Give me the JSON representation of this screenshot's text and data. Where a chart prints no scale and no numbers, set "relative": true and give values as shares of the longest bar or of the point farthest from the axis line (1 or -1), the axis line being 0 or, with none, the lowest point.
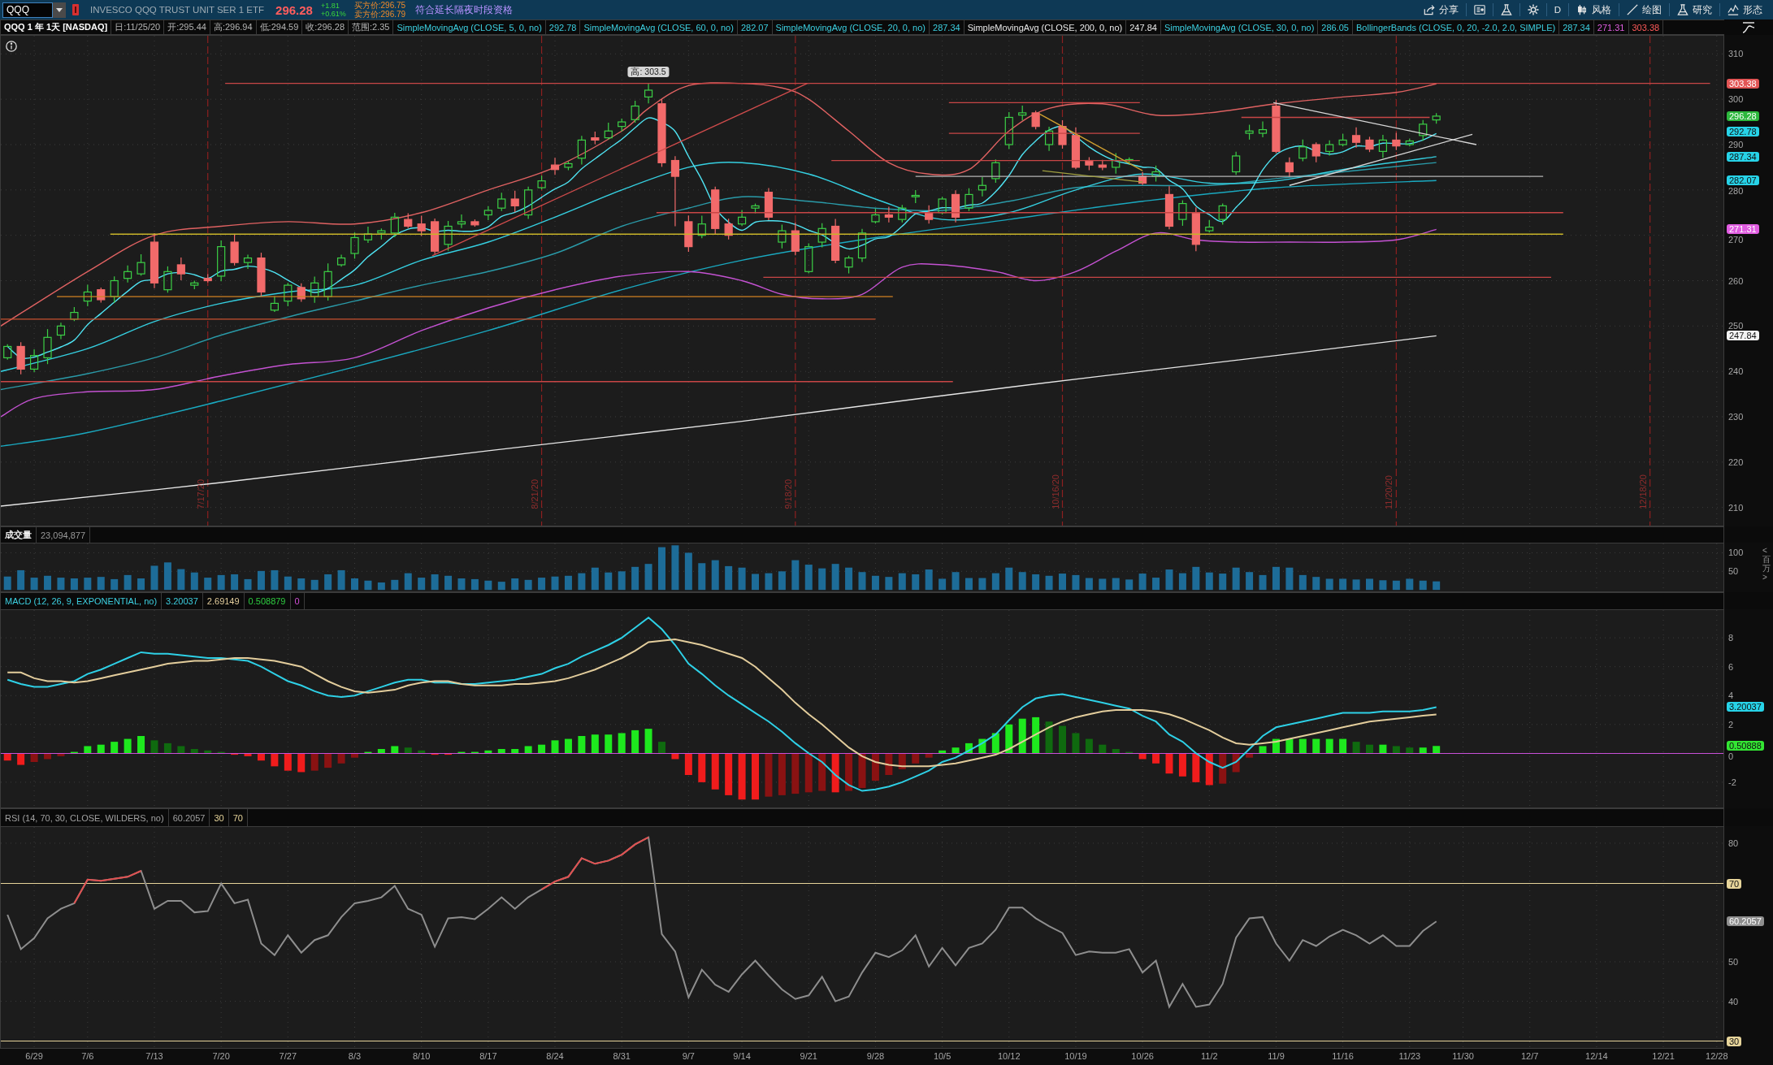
{
  "toolbar": {
    "symbol": "QQQ",
    "description": "INVESCO QQQ TRUST UNIT SER 1 ETF",
    "last_price": "296.28",
    "change": "+1.81",
    "change_percent": "+0.61%",
    "bid": "买方价:296.75",
    "ask": "卖方价:296.79",
    "session_badge": "符合延长隔夜时段资格",
    "buttons": [
      {
        "kind": "share",
        "label": "分享"
      },
      {
        "kind": "news"
      },
      {
        "kind": "flask"
      },
      {
        "kind": "gear"
      },
      {
        "kind": "text",
        "label": "D"
      },
      {
        "kind": "style",
        "label": "风格"
      },
      {
        "kind": "draw",
        "label": "绘图"
      },
      {
        "kind": "flask",
        "label": "研究"
      },
      {
        "kind": "pattern",
        "label": "形态"
      }
    ]
  },
  "study_bar": {
    "title": "QQQ 1 年 1天 [NASDAQ]",
    "quote": [
      "日:11/25/20",
      "开:295.44",
      "高:296.94",
      "低:294.59",
      "收:296.28",
      "范围:2.35"
    ],
    "studies": [
      {
        "label": "SimpleMovingAvg (CLOSE, 5, 0, no)",
        "values": [
          "292.78"
        ]
      },
      {
        "label": "SimpleMovingAvg (CLOSE, 60, 0, no)",
        "values": [
          "282.07"
        ]
      },
      {
        "label": "SimpleMovingAvg (CLOSE, 20, 0, no)",
        "values": [
          "287.34"
        ]
      },
      {
        "label": "SimpleMovingAvg (CLOSE, 200, 0, no)",
        "values": [
          "247.84"
        ]
      },
      {
        "label": "SimpleMovingAvg (CLOSE, 30, 0, no)",
        "values": [
          "286.05"
        ]
      },
      {
        "label": "BollingerBands (CLOSE, 0, 20, -2.0, 2.0, SIMPLE)",
        "values": [
          "287.34",
          "271.31",
          "303.38"
        ]
      }
    ]
  },
  "price_chart": {
    "y_axis_labels": [
      "310",
      "300",
      "290",
      "280",
      "270",
      "260",
      "250",
      "240",
      "230",
      "220",
      "210"
    ],
    "value_tags": [
      {
        "text": "303.38",
        "color": "#e25555"
      },
      {
        "text": "296.28",
        "color": "#2db83d"
      },
      {
        "text": "292.78",
        "color": "#27d3e8"
      },
      {
        "text": "287.34",
        "color": "#27d3e8"
      },
      {
        "text": "282.07",
        "color": "#27d3e8"
      },
      {
        "text": "271.31",
        "color": "#e05ce0"
      },
      {
        "text": "247.84",
        "color": "#f2f2f2"
      }
    ],
    "high_callout": "高: 303.5",
    "expiration_labels": [
      "7/17/20",
      "8/21/20",
      "9/18/20",
      "10/16/20",
      "11/20/20",
      "12/18/20"
    ]
  },
  "volume_panel": {
    "header": [
      "成交量",
      "23,094,877"
    ],
    "chart_data": {
      "type": "bar",
      "grid": true,
      "categories": [
        null,
        null,
        null,
        null,
        null,
        null,
        null,
        null,
        null,
        null,
        null,
        null,
        null,
        null,
        null,
        null,
        null,
        null,
        null,
        null,
        null,
        null,
        null,
        null,
        null,
        null,
        null,
        null,
        null,
        null,
        null,
        null,
        null,
        null,
        null,
        null,
        null,
        null,
        null,
        null,
        null,
        null,
        null,
        null,
        null,
        null,
        null,
        null,
        null,
        null,
        null,
        null,
        null,
        null,
        null,
        null,
        null,
        null,
        null,
        null,
        null,
        null,
        null,
        null,
        null,
        null,
        null,
        null,
        null,
        null,
        null,
        null,
        null,
        null,
        null,
        null,
        null,
        null,
        null,
        null,
        null,
        null,
        null,
        null,
        null,
        null,
        null,
        null,
        null,
        null,
        null,
        null,
        null,
        null,
        null,
        null,
        null,
        null,
        null,
        null,
        null,
        null,
        null,
        null,
        null,
        null,
        null,
        null,
        null,
        null,
        null,
        null,
        null,
        null,
        null,
        null,
        null,
        null,
        null,
        null,
        null,
        null,
        null,
        null,
        null,
        null,
        null,
        null,
        null
      ],
      "ylabel": "<百万>",
      "ylim": [
        -4,
        125
      ],
      "yticks": [
        50,
        100
      ],
      "values": [
        36,
        53,
        33,
        38,
        33,
        31,
        33,
        35,
        29,
        40,
        31,
        65,
        74,
        56,
        47,
        33,
        40,
        42,
        29,
        51,
        53,
        36,
        31,
        27,
        42,
        53,
        31,
        25,
        20,
        27,
        45,
        33,
        42,
        38,
        31,
        29,
        25,
        22,
        31,
        27,
        33,
        36,
        38,
        45,
        60,
        47,
        50,
        62,
        70,
        115,
        120,
        100,
        72,
        80,
        64,
        60,
        43,
        45,
        50,
        80,
        68,
        58,
        70,
        60,
        48,
        38,
        35,
        45,
        42,
        55,
        30,
        48,
        32,
        32,
        45,
        60,
        48,
        42,
        38,
        44,
        40,
        32,
        30,
        32,
        28,
        44,
        33,
        55,
        45,
        62,
        47,
        44,
        60,
        48,
        40,
        62,
        60,
        40,
        35,
        30,
        30,
        28,
        30,
        26,
        25,
        30,
        25,
        23,
        null,
        null,
        null,
        null,
        null,
        null,
        null,
        null,
        null,
        null,
        null,
        null,
        null,
        null,
        null,
        null,
        null,
        null,
        null,
        null,
        null
      ]
    }
  },
  "macd_panel": {
    "header": [
      "MACD (12, 26, 9, EXPONENTIAL, no)",
      "3.20037",
      "2.69149",
      "0.508879",
      "0"
    ],
    "lines": {
      "chart_data": {
        "type": "line",
        "grid": true,
        "categories": [
          null,
          null,
          null,
          null,
          null,
          null,
          null,
          null,
          null,
          null,
          null,
          null,
          null,
          null,
          null,
          null,
          null,
          null,
          null,
          null,
          null,
          null,
          null,
          null,
          null,
          null,
          null,
          null,
          null,
          null,
          null,
          null,
          null,
          null,
          null,
          null,
          null,
          null,
          null,
          null,
          null,
          null,
          null,
          null,
          null,
          null,
          null,
          null,
          null,
          null,
          null,
          null,
          null,
          null,
          null,
          null,
          null,
          null,
          null,
          null,
          null,
          null,
          null,
          null,
          null,
          null,
          null,
          null,
          null,
          null,
          null,
          null,
          null,
          null,
          null,
          null,
          null,
          null,
          null,
          null,
          null,
          null,
          null,
          null,
          null,
          null,
          null,
          null,
          null,
          null,
          null,
          null,
          null,
          null,
          null,
          null,
          null,
          null,
          null,
          null,
          null,
          null,
          null,
          null,
          null,
          null,
          null,
          null,
          null,
          null,
          null,
          null,
          null,
          null,
          null,
          null,
          null,
          null,
          null,
          null,
          null,
          null,
          null,
          null,
          null,
          null,
          null,
          null,
          null
        ],
        "ylim": [
          -3.75,
          9.92
        ],
        "yticks": [
          -2,
          0,
          2,
          4,
          6,
          8
        ],
        "ref_lines": [
          {
            "axis": "y",
            "value": 0,
            "color": "#c84fd8"
          }
        ],
        "series": [
          {
            "color": "#2ed0e6",
            "values": [
              5.1,
              4.8,
              4.6,
              4.6,
              4.8,
              5.0,
              5.5,
              5.8,
              6.2,
              6.6,
              7.0,
              6.9,
              6.9,
              6.8,
              6.7,
              6.6,
              6.6,
              6.5,
              6.4,
              6.0,
              5.5,
              5.0,
              4.7,
              4.3,
              4.0,
              3.9,
              4.0,
              4.3,
              4.6,
              4.9,
              5.1,
              5.1,
              4.9,
              4.9,
              4.8,
              4.8,
              4.9,
              5.0,
              5.1,
              5.3,
              5.5,
              5.9,
              6.2,
              6.7,
              7.1,
              7.5,
              8.0,
              8.7,
              9.4,
              8.6,
              7.5,
              6.2,
              5.5,
              4.7,
              4.0,
              3.4,
              2.8,
              2.2,
              1.5,
              0.7,
              0.0,
              -0.6,
              -1.5,
              -2.2,
              -2.6,
              -2.5,
              -2.3,
              -2.0,
              -1.6,
              -1.2,
              -0.6,
              -0.3,
              0.2,
              0.7,
              1.3,
              2.3,
              3.2,
              3.8,
              4.0,
              4.1,
              3.9,
              3.7,
              3.5,
              3.3,
              3.1,
              2.6,
              2.2,
              1.3,
              0.8,
              0.0,
              -0.6,
              -1.0,
              -0.6,
              0.3,
              1.2,
              1.8,
              2.0,
              2.2,
              2.4,
              2.6,
              2.8,
              2.8,
              2.8,
              2.9,
              2.9,
              2.9,
              3.0,
              3.2,
              null,
              null,
              null,
              null,
              null,
              null,
              null,
              null,
              null,
              null,
              null,
              null,
              null,
              null,
              null,
              null,
              null,
              null,
              null,
              null,
              null
            ]
          },
          {
            "color": "#e3cd9c",
            "values": [
              5.6,
              5.6,
              5.2,
              5.0,
              5.0,
              4.9,
              5.0,
              5.2,
              5.4,
              5.6,
              5.8,
              6.0,
              6.2,
              6.3,
              6.4,
              6.4,
              6.5,
              6.6,
              6.6,
              6.5,
              6.4,
              6.2,
              6.0,
              5.5,
              5.0,
              4.6,
              4.3,
              4.2,
              4.3,
              4.4,
              4.7,
              4.9,
              5.0,
              5.0,
              4.8,
              4.7,
              4.7,
              4.7,
              4.8,
              4.8,
              4.9,
              5.0,
              5.2,
              5.5,
              5.8,
              6.2,
              6.6,
              7.1,
              7.7,
              7.8,
              7.9,
              7.7,
              7.5,
              7.2,
              6.9,
              6.6,
              6.0,
              5.2,
              4.4,
              3.5,
              2.7,
              2.0,
              1.2,
              0.4,
              -0.2,
              -0.6,
              -0.8,
              -0.9,
              -0.9,
              -0.9,
              -0.8,
              -0.7,
              -0.5,
              -0.3,
              -0.1,
              0.3,
              0.8,
              1.3,
              1.8,
              2.2,
              2.5,
              2.7,
              2.9,
              3.0,
              3.0,
              3.0,
              2.9,
              2.7,
              2.4,
              2.0,
              1.6,
              1.1,
              0.7,
              0.6,
              0.7,
              0.8,
              1.0,
              1.2,
              1.4,
              1.6,
              1.8,
              2.0,
              2.2,
              2.3,
              2.4,
              2.5,
              2.6,
              2.69,
              null,
              null,
              null,
              null,
              null,
              null,
              null,
              null,
              null,
              null,
              null,
              null,
              null,
              null,
              null,
              null,
              null,
              null,
              null,
              null,
              null
            ]
          }
        ]
      }
    },
    "histogram": {
      "chart_data": {
        "type": "bar",
        "relative": true,
        "grid": true,
        "categories": [
          null,
          null,
          null,
          null,
          null,
          null,
          null,
          null,
          null,
          null,
          null,
          null,
          null,
          null,
          null,
          null,
          null,
          null,
          null,
          null,
          null,
          null,
          null,
          null,
          null,
          null,
          null,
          null,
          null,
          null,
          null,
          null,
          null,
          null,
          null,
          null,
          null,
          null,
          null,
          null,
          null,
          null,
          null,
          null,
          null,
          null,
          null,
          null,
          null,
          null,
          null,
          null,
          null,
          null,
          null,
          null,
          null,
          null,
          null,
          null,
          null,
          null,
          null,
          null,
          null,
          null,
          null,
          null,
          null,
          null,
          null,
          null,
          null,
          null,
          null,
          null,
          null,
          null,
          null,
          null,
          null,
          null,
          null,
          null,
          null,
          null,
          null,
          null,
          null,
          null,
          null,
          null,
          null,
          null,
          null,
          null,
          null,
          null,
          null,
          null,
          null,
          null,
          null,
          null,
          null,
          null,
          null,
          null,
          null,
          null,
          null,
          null,
          null,
          null,
          null,
          null,
          null,
          null,
          null,
          null,
          null,
          null,
          null,
          null,
          null,
          null,
          null,
          null,
          null
        ],
        "ylim": [
          -3.75,
          9.92
        ],
        "values": [
          -0.5,
          -0.8,
          -0.6,
          -0.4,
          -0.2,
          0.1,
          0.5,
          0.6,
          0.8,
          1.0,
          1.2,
          0.9,
          0.7,
          0.5,
          0.3,
          0.2,
          0.1,
          -0.1,
          -0.2,
          -0.5,
          -0.9,
          -1.2,
          -1.3,
          -1.2,
          -1.0,
          -0.7,
          -0.3,
          0.1,
          0.3,
          0.5,
          0.4,
          0.2,
          -0.1,
          -0.1,
          0.1,
          0.1,
          0.2,
          0.3,
          0.3,
          0.5,
          0.6,
          0.9,
          1.0,
          1.2,
          1.3,
          1.3,
          1.4,
          1.6,
          1.7,
          0.8,
          -0.4,
          -1.5,
          -2.0,
          -2.5,
          -2.9,
          -3.2,
          -3.2,
          -3.0,
          -2.9,
          -2.8,
          -2.7,
          -2.6,
          -2.7,
          -2.6,
          -2.4,
          -1.9,
          -1.5,
          -1.1,
          -0.7,
          -0.3,
          0.2,
          0.4,
          0.7,
          1.0,
          1.4,
          2.0,
          2.4,
          2.5,
          2.2,
          1.9,
          1.4,
          1.0,
          0.6,
          0.3,
          0.1,
          -0.4,
          -0.7,
          -1.4,
          -1.6,
          -2.0,
          -2.2,
          -2.1,
          -1.3,
          -0.3,
          0.5,
          1.0,
          1.0,
          1.0,
          1.0,
          1.0,
          1.0,
          0.8,
          0.6,
          0.6,
          0.5,
          0.4,
          0.4,
          0.51,
          null,
          null,
          null,
          null,
          null,
          null,
          null,
          null,
          null,
          null,
          null,
          null,
          null,
          null,
          null,
          null,
          null,
          null,
          null,
          null,
          null
        ]
      }
    },
    "value_tags": [
      {
        "text": "3.20037",
        "color": "#27d3e8"
      },
      {
        "text": "0.50888",
        "color": "#33e633"
      }
    ]
  },
  "rsi_panel": {
    "header": [
      "RSI (14, 70, 30, CLOSE, WILDERS, no)",
      "60.2057",
      "30",
      "70"
    ],
    "chart_data": {
      "type": "line",
      "grid": true,
      "ylim": [
        28.2,
        84.1
      ],
      "yticks": [
        40,
        50,
        80
      ],
      "ref_lines": [
        {
          "axis": "y",
          "value": 70,
          "label": "70",
          "color": "#e6d49a"
        },
        {
          "axis": "y",
          "value": 30,
          "label": "30",
          "color": "#e6d49a"
        }
      ],
      "categories": [
        null,
        null,
        "6/29",
        null,
        null,
        null,
        "7/6",
        null,
        null,
        null,
        null,
        "7/13",
        null,
        null,
        null,
        null,
        "7/20",
        null,
        null,
        null,
        null,
        "7/27",
        null,
        null,
        null,
        null,
        "8/3",
        null,
        null,
        null,
        null,
        "8/10",
        null,
        null,
        null,
        null,
        "8/17",
        null,
        null,
        null,
        null,
        "8/24",
        null,
        null,
        null,
        null,
        "8/31",
        null,
        null,
        null,
        null,
        "9/7",
        null,
        null,
        null,
        "9/14",
        null,
        null,
        null,
        null,
        "9/21",
        null,
        null,
        null,
        null,
        "9/28",
        null,
        null,
        null,
        null,
        "10/5",
        null,
        null,
        null,
        null,
        "10/12",
        null,
        null,
        null,
        null,
        "10/19",
        null,
        null,
        null,
        null,
        "10/26",
        null,
        null,
        null,
        null,
        "11/2",
        null,
        null,
        null,
        null,
        "11/9",
        null,
        null,
        null,
        null,
        "11/16",
        null,
        null,
        null,
        null,
        "11/23",
        null,
        null,
        null,
        "11/30",
        null,
        null,
        null,
        null,
        "12/7",
        null,
        null,
        null,
        null,
        "12/14",
        null,
        null,
        null,
        null,
        "12/21",
        null,
        null,
        null,
        "12/28"
      ],
      "series": [
        {
          "color": "#8e8e8e",
          "values": [
            61.9,
            53.2,
            56,
            61,
            63.4,
            64.8,
            70.8,
            70.5,
            71,
            71.5,
            73,
            63.4,
            65.4,
            65.4,
            62.5,
            62.8,
            69.8,
            64.8,
            65.7,
            54.6,
            51.7,
            56.7,
            52.3,
            55.5,
            56.7,
            61.3,
            64.8,
            65.4,
            66.3,
            69.2,
            63.4,
            61.9,
            53.8,
            61,
            61.3,
            60.8,
            63.4,
            66.3,
            63.4,
            66.3,
            68.3,
            70.3,
            71.5,
            76.2,
            74.8,
            75.6,
            77.1,
            79.7,
            81.5,
            57,
            52.6,
            41,
            48,
            44.2,
            42.4,
            46.8,
            50.3,
            46.5,
            43,
            40.6,
            41.5,
            46.2,
            40,
            41.2,
            47.3,
            52.3,
            51.2,
            52.9,
            56.7,
            48.8,
            53.5,
            49.1,
            53.5,
            54.6,
            58.1,
            63.7,
            63.7,
            61,
            59,
            57.3,
            51.7,
            52.6,
            52.3,
            52.3,
            53.2,
            47.3,
            50.3,
            38.6,
            44.4,
            38.6,
            39.2,
            44.4,
            56.1,
            61,
            61.3,
            54.6,
            50.3,
            55.5,
            54,
            56.4,
            58.1,
            56.7,
            54.6,
            56.7,
            54,
            54,
            57.8,
            60.2,
            null,
            null,
            null,
            null,
            null,
            null,
            null,
            null,
            null,
            null,
            null,
            null,
            null,
            null,
            null,
            null,
            null,
            null,
            null,
            null,
            null
          ]
        },
        {
          "color": "#e05050",
          "values": [
            null,
            null,
            null,
            null,
            null,
            64.8,
            70.8,
            70.5,
            71,
            71.5,
            73,
            null,
            null,
            null,
            null,
            null,
            null,
            null,
            null,
            null,
            null,
            null,
            null,
            null,
            null,
            null,
            null,
            null,
            null,
            null,
            null,
            null,
            null,
            null,
            null,
            null,
            null,
            null,
            null,
            null,
            68.3,
            70.3,
            71.5,
            76.2,
            74.8,
            75.6,
            77.1,
            79.7,
            81.5,
            null,
            null,
            null,
            null,
            null,
            null,
            null,
            null,
            null,
            null,
            null,
            null,
            null,
            null,
            null,
            null,
            null,
            null,
            null,
            null,
            null,
            null,
            null,
            null,
            null,
            null,
            null,
            null,
            null,
            null,
            null,
            null,
            null,
            null,
            null,
            null,
            null,
            null,
            null,
            null,
            null,
            null,
            null,
            null,
            null,
            null,
            null,
            null,
            null,
            null,
            null,
            null,
            null,
            null,
            null,
            null,
            null,
            null,
            null,
            null,
            null,
            null,
            null,
            null,
            null,
            null,
            null,
            null,
            null,
            null,
            null,
            null,
            null,
            null,
            null,
            null,
            null,
            null,
            null,
            null
          ]
        }
      ]
    },
    "last_value_tag": "60.2057"
  }
}
